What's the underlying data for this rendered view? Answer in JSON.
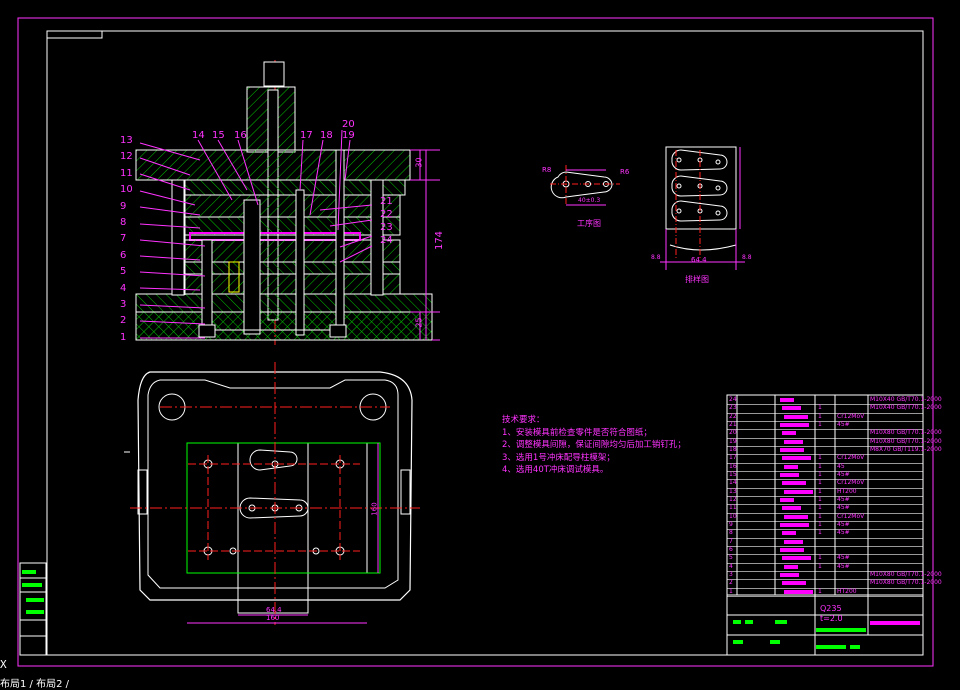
{
  "colors": {
    "background": "#000000",
    "frame": "#ffffff",
    "part_outline": "#ffffff",
    "center_line": "#ff2020",
    "hatch": "#00c800",
    "dimension": "#ff33ff",
    "cyan": "#00c8c8",
    "yellow": "#ffff00",
    "green_fill": "#00ff00",
    "magenta_fill": "#ff00ff"
  },
  "drawing": {
    "section_leader_numbers": [
      "13",
      "12",
      "11",
      "10",
      "9",
      "8",
      "7",
      "6",
      "5",
      "4",
      "3",
      "2",
      "1"
    ],
    "top_leader_numbers": [
      "14",
      "15",
      "16",
      "17",
      "18",
      "19",
      "20"
    ],
    "right_leader_numbers": [
      "21",
      "22",
      "23",
      "24"
    ],
    "height_dims": {
      "total": "174",
      "top": "30",
      "bottom": "25"
    },
    "workpiece_label": "工序图",
    "layout_label": "排样图",
    "workpiece_dims": {
      "r1": "R8",
      "r2": "R6",
      "width": "40±0.3"
    },
    "layout_dims": {
      "pitch": "64.4",
      "side_a": "8.8",
      "side_b": "8.8"
    },
    "plan_dims": {
      "width": "160",
      "inner": "64.4",
      "height": "160"
    }
  },
  "tech_requirements": {
    "title": "技术要求：",
    "items": [
      "1、安装模具前检查零件是否符合图纸；",
      "2、调整模具间隙，保证间隙均匀后加工销钉孔；",
      "3、选用1号冲床配导柱模架；",
      "4、选用40T冲床调试模具。"
    ]
  },
  "bom": {
    "rows": [
      {
        "no": "24",
        "qty": "",
        "material": "",
        "spec": "M10X40 GB/T70.1-2000"
      },
      {
        "no": "23",
        "qty": "1",
        "material": "",
        "spec": "M10X40 GB/T70.1-2000"
      },
      {
        "no": "22",
        "qty": "1",
        "material": "Cr12MoV",
        "spec": ""
      },
      {
        "no": "21",
        "qty": "1",
        "material": "45#",
        "spec": ""
      },
      {
        "no": "20",
        "qty": "",
        "material": "",
        "spec": "M10X80 GB/T70.1-2000"
      },
      {
        "no": "19",
        "qty": "",
        "material": "",
        "spec": "M10X80 GB/T70.1-2000"
      },
      {
        "no": "18",
        "qty": "",
        "material": "",
        "spec": "M8X70 GB/T119.1-2000"
      },
      {
        "no": "17",
        "qty": "1",
        "material": "Cr12MoV",
        "spec": ""
      },
      {
        "no": "16",
        "qty": "1",
        "material": "45",
        "spec": ""
      },
      {
        "no": "15",
        "qty": "1",
        "material": "45#",
        "spec": ""
      },
      {
        "no": "14",
        "qty": "1",
        "material": "Cr12MoV",
        "spec": ""
      },
      {
        "no": "13",
        "qty": "1",
        "material": "HT200",
        "spec": ""
      },
      {
        "no": "12",
        "qty": "1",
        "material": "45#",
        "spec": ""
      },
      {
        "no": "11",
        "qty": "1",
        "material": "45#",
        "spec": ""
      },
      {
        "no": "10",
        "qty": "1",
        "material": "Cr12MoV",
        "spec": ""
      },
      {
        "no": "9",
        "qty": "1",
        "material": "45#",
        "spec": ""
      },
      {
        "no": "8",
        "qty": "1",
        "material": "45#",
        "spec": ""
      },
      {
        "no": "7",
        "qty": "",
        "material": "",
        "spec": ""
      },
      {
        "no": "6",
        "qty": "",
        "material": "",
        "spec": ""
      },
      {
        "no": "5",
        "qty": "1",
        "material": "45#",
        "spec": ""
      },
      {
        "no": "4",
        "qty": "1",
        "material": "45#",
        "spec": ""
      },
      {
        "no": "3",
        "qty": "",
        "material": "",
        "spec": "M10X80 GB/T70.1-2000"
      },
      {
        "no": "2",
        "qty": "",
        "material": "",
        "spec": "M10X80 GB/T70.1-2000"
      },
      {
        "no": "1",
        "qty": "1",
        "material": "HT200",
        "spec": ""
      }
    ],
    "title_material": "Q235",
    "title_thickness": "t=2.0"
  },
  "command_line": {
    "prompt": "X",
    "tabs": "布局1 / 布局2 /"
  }
}
